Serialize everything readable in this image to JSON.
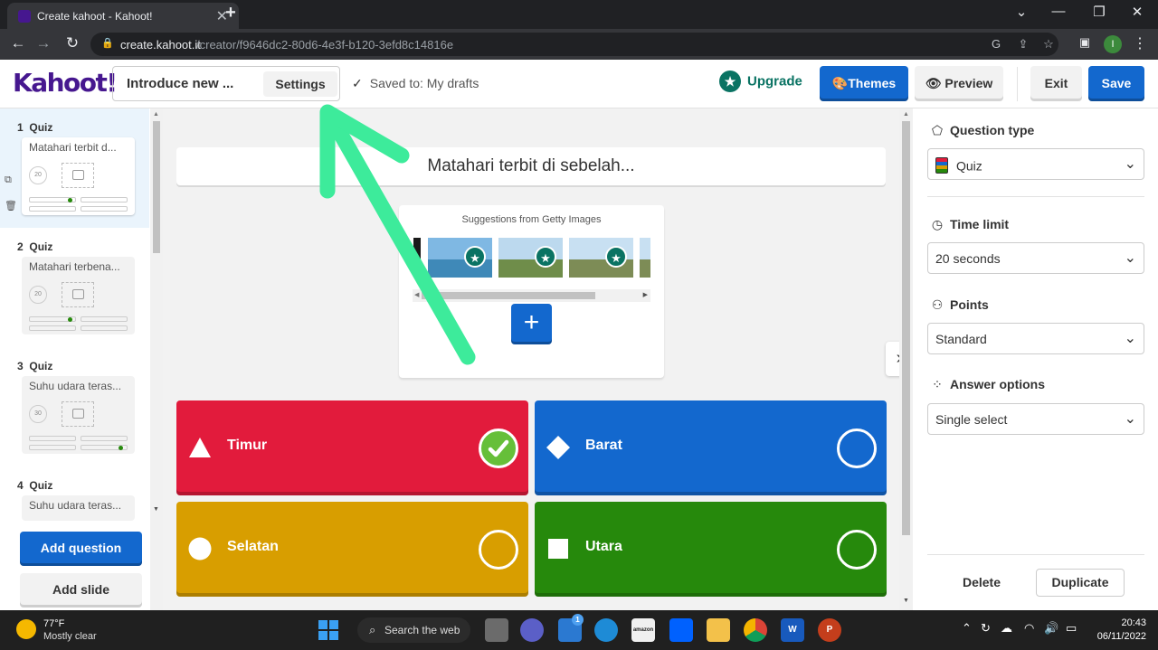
{
  "browser": {
    "tab_title": "Create kahoot - Kahoot!",
    "tab_close": "✕",
    "new_tab": "+",
    "url_host": "create.kahoot.it",
    "url_path": "/creator/f9646dc2-80d6-4e3f-b120-3efd8c14816e",
    "profile_initial": "I"
  },
  "header": {
    "logo": "Kahoot!",
    "kahoot_title": "Introduce new ...",
    "settings_label": "Settings",
    "saved_status": "Saved to: My drafts",
    "upgrade_label": "Upgrade",
    "themes_label": "Themes",
    "preview_label": "Preview",
    "exit_label": "Exit",
    "save_label": "Save"
  },
  "slides": [
    {
      "number": "1",
      "type": "Quiz",
      "title": "Matahari terbit d...",
      "time": "20",
      "correct_index": 0
    },
    {
      "number": "2",
      "type": "Quiz",
      "title": "Matahari terbena...",
      "time": "20",
      "correct_index": 0
    },
    {
      "number": "3",
      "type": "Quiz",
      "title": "Suhu udara teras...",
      "time": "30",
      "correct_index": 3
    },
    {
      "number": "4",
      "type": "Quiz",
      "title": "Suhu udara teras...",
      "time": "",
      "correct_index": null
    }
  ],
  "sidebar_buttons": {
    "add_question": "Add question",
    "add_slide": "Add slide"
  },
  "editor": {
    "question": "Matahari terbit di sebelah...",
    "media_suggestions_label": "Suggestions from Getty Images",
    "add_media": "+",
    "answers": [
      {
        "text": "Timur",
        "color": "#e21b3c",
        "shape": "triangle",
        "correct": true
      },
      {
        "text": "Barat",
        "color": "#1368ce",
        "shape": "diamond",
        "correct": false
      },
      {
        "text": "Selatan",
        "color": "#d89e00",
        "shape": "circle",
        "correct": false
      },
      {
        "text": "Utara",
        "color": "#26890c",
        "shape": "square",
        "correct": false
      }
    ]
  },
  "settings_panel": {
    "question_type_label": "Question type",
    "question_type_value": "Quiz",
    "time_limit_label": "Time limit",
    "time_limit_value": "20 seconds",
    "points_label": "Points",
    "points_value": "Standard",
    "answer_options_label": "Answer options",
    "answer_options_value": "Single select",
    "delete_label": "Delete",
    "duplicate_label": "Duplicate"
  },
  "taskbar": {
    "weather_temp": "77°F",
    "weather_desc": "Mostly clear",
    "search_label": "Search the web",
    "mail_badge": "1",
    "time": "20:43",
    "date": "06/11/2022"
  },
  "colors": {
    "kahoot_purple": "#46178f",
    "primary_blue": "#1368ce",
    "annotation_arrow": "#3deb9b"
  }
}
